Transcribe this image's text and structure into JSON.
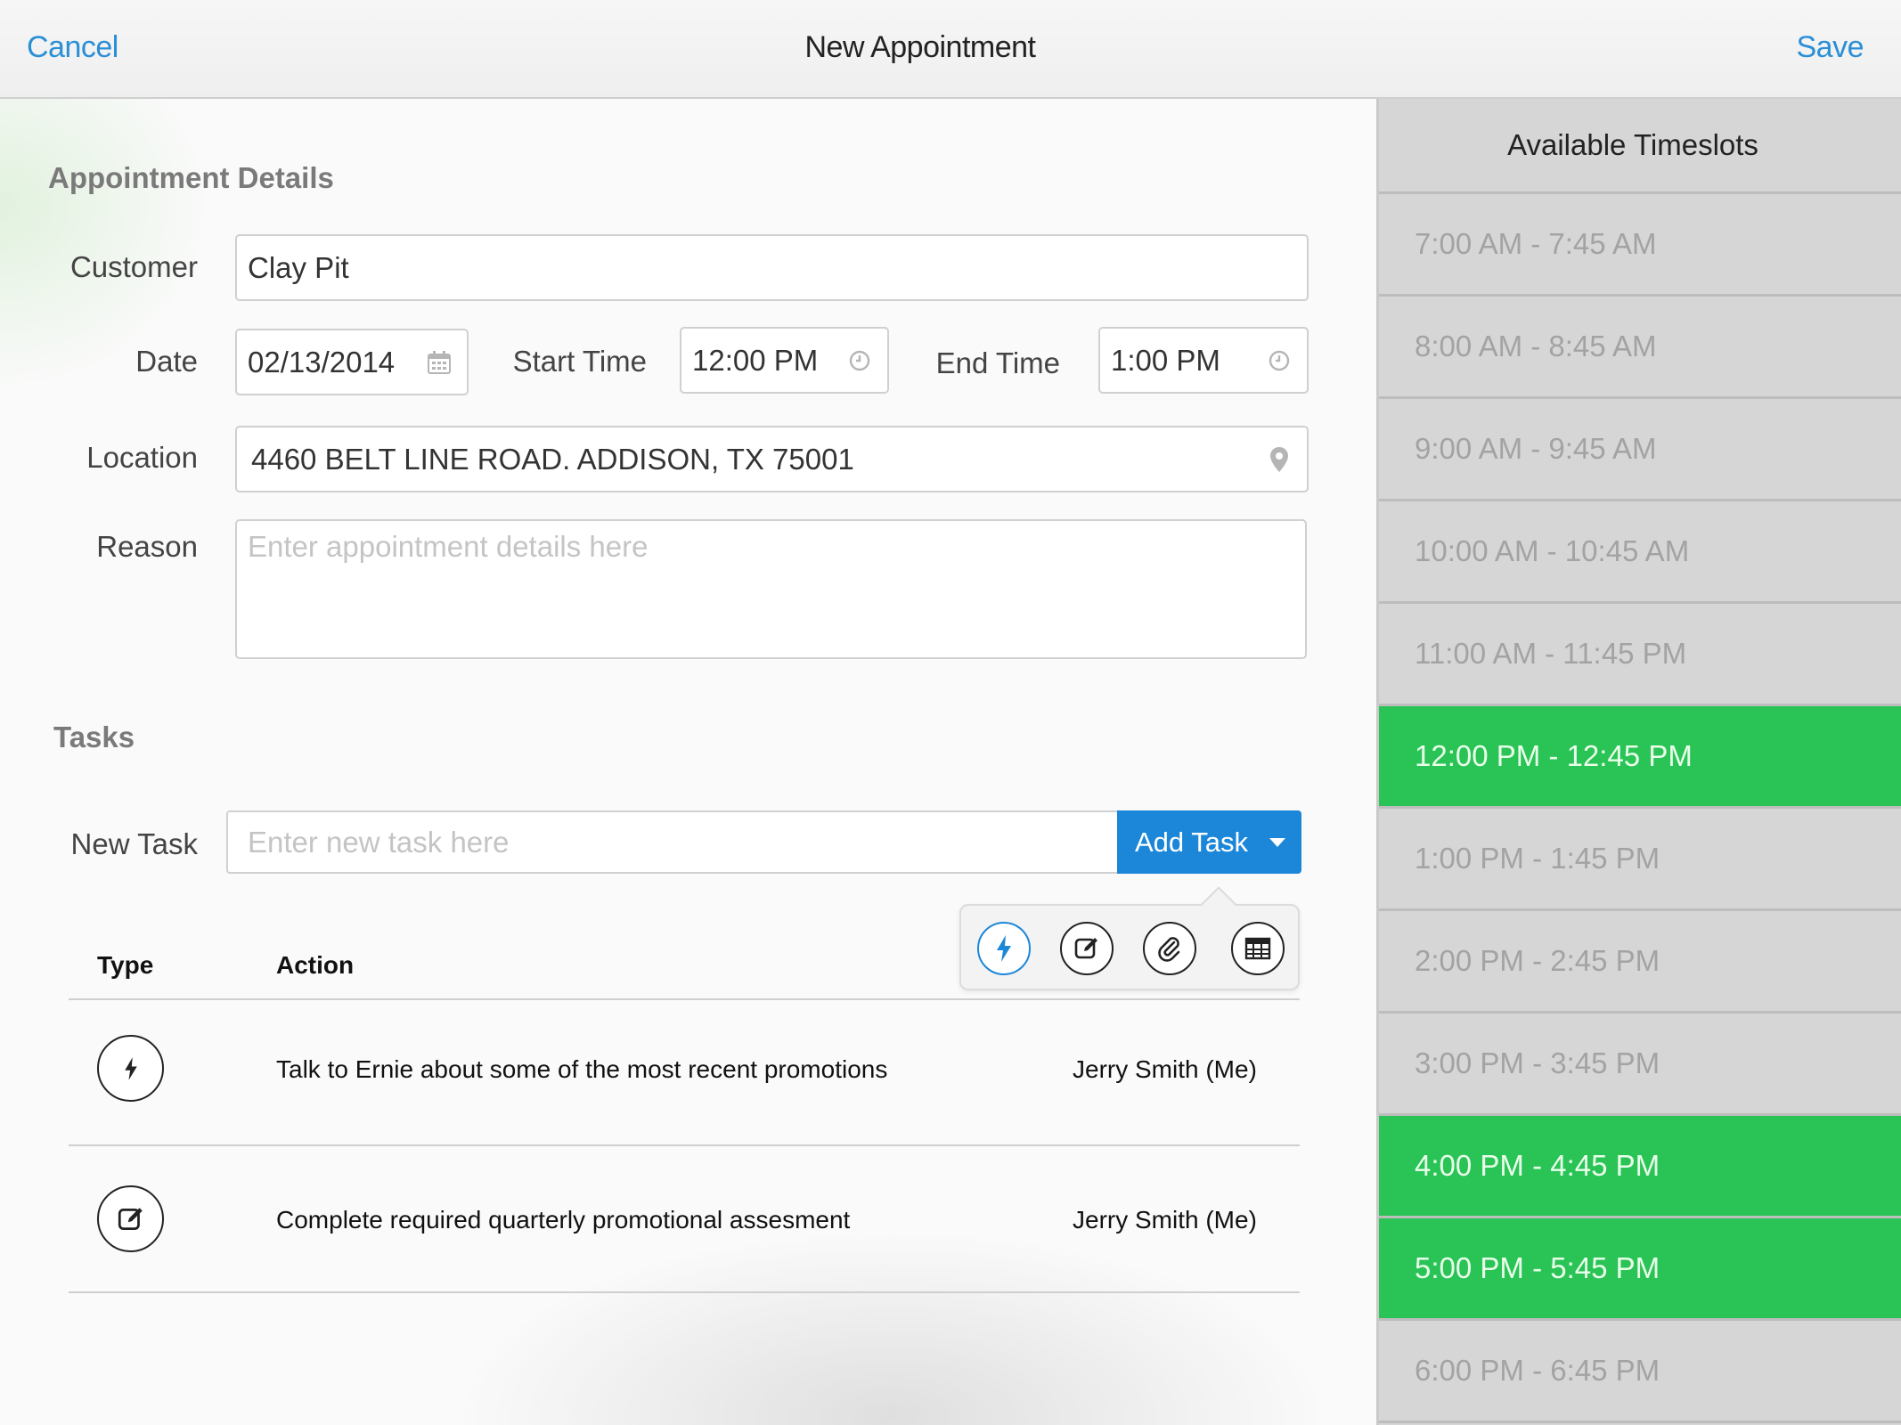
{
  "header": {
    "cancel_label": "Cancel",
    "title": "New Appointment",
    "save_label": "Save"
  },
  "details": {
    "section_title": "Appointment Details",
    "customer_label": "Customer",
    "customer_value": "Clay Pit",
    "date_label": "Date",
    "date_value": "02/13/2014",
    "start_label": "Start Time",
    "start_value": "12:00 PM",
    "end_label": "End Time",
    "end_value": "1:00 PM",
    "location_label": "Location",
    "location_value": "4460 BELT LINE ROAD. ADDISON, TX 75001",
    "reason_label": "Reason",
    "reason_placeholder": "Enter appointment details here"
  },
  "tasks": {
    "section_title": "Tasks",
    "new_task_label": "New Task",
    "new_task_placeholder": "Enter new task here",
    "add_task_label": "Add Task",
    "col_type": "Type",
    "col_action": "Action",
    "rows": [
      {
        "icon": "lightning-icon",
        "action": "Talk to Ernie about some of the most recent promotions",
        "owner": "Jerry Smith (Me)"
      },
      {
        "icon": "edit-icon",
        "action": "Complete required  quarterly promotional assesment",
        "owner": "Jerry Smith (Me)"
      }
    ],
    "popover_icons": [
      "lightning-icon",
      "edit-icon",
      "paperclip-icon",
      "table-icon"
    ]
  },
  "timeslots": {
    "title": "Available Timeslots",
    "accent_color": "#29c356",
    "items": [
      {
        "label": "7:00 AM - 7:45 AM",
        "available": false
      },
      {
        "label": "8:00 AM - 8:45 AM",
        "available": false
      },
      {
        "label": "9:00 AM - 9:45 AM",
        "available": false
      },
      {
        "label": "10:00 AM - 10:45 AM",
        "available": false
      },
      {
        "label": "11:00 AM - 11:45 PM",
        "available": false
      },
      {
        "label": "12:00 PM - 12:45 PM",
        "available": true
      },
      {
        "label": "1:00 PM - 1:45 PM",
        "available": false
      },
      {
        "label": "2:00 PM - 2:45 PM",
        "available": false
      },
      {
        "label": "3:00 PM - 3:45 PM",
        "available": false
      },
      {
        "label": "4:00 PM - 4:45 PM",
        "available": true
      },
      {
        "label": "5:00 PM - 5:45 PM",
        "available": true
      },
      {
        "label": "6:00 PM - 6:45 PM",
        "available": false
      }
    ]
  }
}
